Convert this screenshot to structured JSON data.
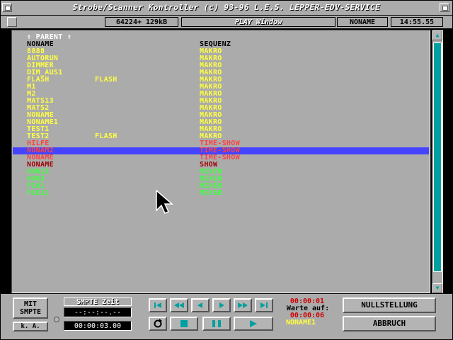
{
  "window": {
    "title": "Strobe/Scanner Kontroller (c) 93-96 L.E.S. LEPPER-EDV-SERVICE",
    "memory": "64224+ 129kB",
    "mode": "PLAY Window",
    "current_name": "NONAME",
    "clock": "14:55.55"
  },
  "list": {
    "parent": "↑ PARENT ↑",
    "header": {
      "name": "NONAME",
      "type": "SEQUENZ"
    },
    "rows": [
      {
        "name": "8888",
        "flag": "",
        "type": "MAKRO",
        "color": "yel"
      },
      {
        "name": "AUTORUN",
        "flag": "",
        "type": "MAKRO",
        "color": "yel"
      },
      {
        "name": "DIMMER",
        "flag": "",
        "type": "MAKRO",
        "color": "yel"
      },
      {
        "name": "DIM_AUS1",
        "flag": "",
        "type": "MAKRO",
        "color": "yel"
      },
      {
        "name": "FLASH",
        "flag": "FLASH",
        "type": "MAKRO",
        "color": "yel"
      },
      {
        "name": "M1",
        "flag": "",
        "type": "MAKRO",
        "color": "yel"
      },
      {
        "name": "M2",
        "flag": "",
        "type": "MAKRO",
        "color": "yel"
      },
      {
        "name": "MATS13",
        "flag": "",
        "type": "MAKRO",
        "color": "yel"
      },
      {
        "name": "MATS2",
        "flag": "",
        "type": "MAKRO",
        "color": "yel"
      },
      {
        "name": "NONAME",
        "flag": "",
        "type": "MAKRO",
        "color": "yel"
      },
      {
        "name": "NONAME1",
        "flag": "",
        "type": "MAKRO",
        "color": "yel"
      },
      {
        "name": "TEST1",
        "flag": "",
        "type": "MAKRO",
        "color": "yel"
      },
      {
        "name": "TEST2",
        "flag": "FLASH",
        "type": "MAKRO",
        "color": "yel"
      },
      {
        "name": "HILFE",
        "flag": "",
        "type": "TIME-SHOW",
        "color": "red"
      },
      {
        "name": "NONAM2",
        "flag": "",
        "type": "TIME-SHOW",
        "color": "red",
        "selected": true
      },
      {
        "name": "NONAME",
        "flag": "",
        "type": "TIME-SHOW",
        "color": "red"
      },
      {
        "name": "NONAME",
        "flag": "",
        "type": "SHOW",
        "color": "dred"
      },
      {
        "name": "NON23",
        "flag": "",
        "type": "MIXER",
        "color": "grn"
      },
      {
        "name": "NON3",
        "flag": "",
        "type": "MIXER",
        "color": "grn"
      },
      {
        "name": "PIU1",
        "flag": "",
        "type": "MIXER",
        "color": "grn"
      },
      {
        "name": "PIU11",
        "flag": "",
        "type": "MIXER",
        "color": "grn"
      }
    ]
  },
  "controls": {
    "mit_smpte": "MIT\nSMPTE",
    "ka": "k. A.",
    "smpte_label": "SMPTE Zeit",
    "smpte_display": "--:--:--.--",
    "smpte_time": "00:00:03.00",
    "time1": "00:00:01",
    "warte_auf": "Warte auf:",
    "time2": "00:00:06",
    "wait_name": "NONAME1",
    "null_button": "NULLSTELLUNG",
    "abort_button": "ABBRUCH"
  },
  "colors": {
    "panel": "#ababab",
    "makro": "#ffff40",
    "timeshow": "#ff4040",
    "mixer": "#40ff40",
    "selection": "#4444ff",
    "scrollbar": "#00a0a0"
  }
}
